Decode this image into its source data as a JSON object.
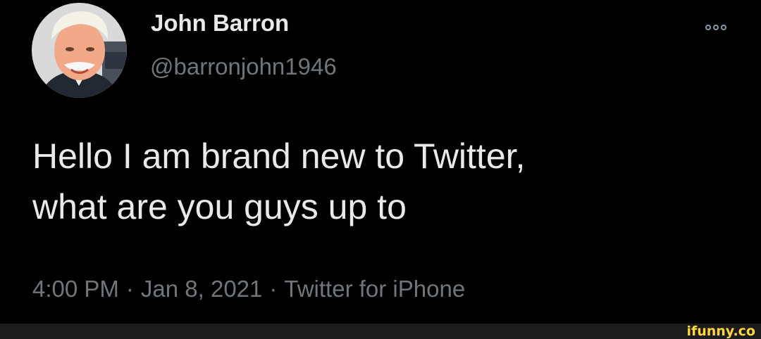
{
  "tweet": {
    "author": {
      "display_name": "John Barron",
      "handle": "@barronjohn1946",
      "avatar_icon": "profile-photo"
    },
    "more_icon": "more-options-icon",
    "text_lines": [
      "Hello I am brand new to Twitter,",
      "what are you guys up to"
    ],
    "meta": {
      "time": "4:00 PM",
      "separator": "·",
      "date": "Jan 8, 2021",
      "source": "Twitter for iPhone"
    }
  },
  "watermark": {
    "text": "ifunny.co",
    "color": "#ffd53d"
  },
  "colors": {
    "background": "#000000",
    "primary_text": "#e7e9ea",
    "secondary_text": "#71767b"
  }
}
